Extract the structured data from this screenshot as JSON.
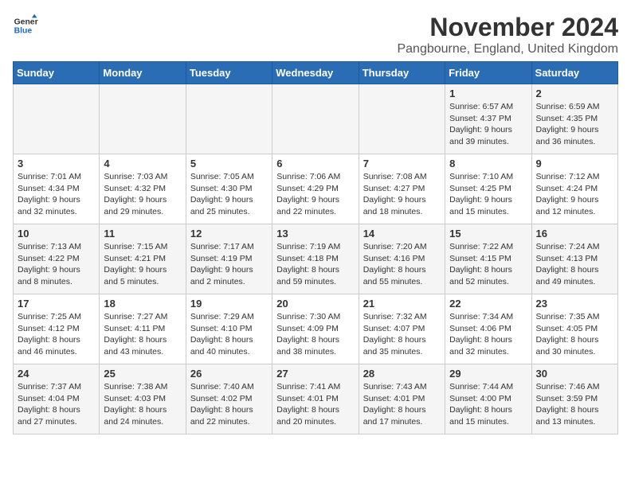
{
  "logo": {
    "text_general": "General",
    "text_blue": "Blue"
  },
  "header": {
    "month_year": "November 2024",
    "location": "Pangbourne, England, United Kingdom"
  },
  "weekdays": [
    "Sunday",
    "Monday",
    "Tuesday",
    "Wednesday",
    "Thursday",
    "Friday",
    "Saturday"
  ],
  "weeks": [
    [
      {
        "day": "",
        "info": ""
      },
      {
        "day": "",
        "info": ""
      },
      {
        "day": "",
        "info": ""
      },
      {
        "day": "",
        "info": ""
      },
      {
        "day": "",
        "info": ""
      },
      {
        "day": "1",
        "info": "Sunrise: 6:57 AM\nSunset: 4:37 PM\nDaylight: 9 hours\nand 39 minutes."
      },
      {
        "day": "2",
        "info": "Sunrise: 6:59 AM\nSunset: 4:35 PM\nDaylight: 9 hours\nand 36 minutes."
      }
    ],
    [
      {
        "day": "3",
        "info": "Sunrise: 7:01 AM\nSunset: 4:34 PM\nDaylight: 9 hours\nand 32 minutes."
      },
      {
        "day": "4",
        "info": "Sunrise: 7:03 AM\nSunset: 4:32 PM\nDaylight: 9 hours\nand 29 minutes."
      },
      {
        "day": "5",
        "info": "Sunrise: 7:05 AM\nSunset: 4:30 PM\nDaylight: 9 hours\nand 25 minutes."
      },
      {
        "day": "6",
        "info": "Sunrise: 7:06 AM\nSunset: 4:29 PM\nDaylight: 9 hours\nand 22 minutes."
      },
      {
        "day": "7",
        "info": "Sunrise: 7:08 AM\nSunset: 4:27 PM\nDaylight: 9 hours\nand 18 minutes."
      },
      {
        "day": "8",
        "info": "Sunrise: 7:10 AM\nSunset: 4:25 PM\nDaylight: 9 hours\nand 15 minutes."
      },
      {
        "day": "9",
        "info": "Sunrise: 7:12 AM\nSunset: 4:24 PM\nDaylight: 9 hours\nand 12 minutes."
      }
    ],
    [
      {
        "day": "10",
        "info": "Sunrise: 7:13 AM\nSunset: 4:22 PM\nDaylight: 9 hours\nand 8 minutes."
      },
      {
        "day": "11",
        "info": "Sunrise: 7:15 AM\nSunset: 4:21 PM\nDaylight: 9 hours\nand 5 minutes."
      },
      {
        "day": "12",
        "info": "Sunrise: 7:17 AM\nSunset: 4:19 PM\nDaylight: 9 hours\nand 2 minutes."
      },
      {
        "day": "13",
        "info": "Sunrise: 7:19 AM\nSunset: 4:18 PM\nDaylight: 8 hours\nand 59 minutes."
      },
      {
        "day": "14",
        "info": "Sunrise: 7:20 AM\nSunset: 4:16 PM\nDaylight: 8 hours\nand 55 minutes."
      },
      {
        "day": "15",
        "info": "Sunrise: 7:22 AM\nSunset: 4:15 PM\nDaylight: 8 hours\nand 52 minutes."
      },
      {
        "day": "16",
        "info": "Sunrise: 7:24 AM\nSunset: 4:13 PM\nDaylight: 8 hours\nand 49 minutes."
      }
    ],
    [
      {
        "day": "17",
        "info": "Sunrise: 7:25 AM\nSunset: 4:12 PM\nDaylight: 8 hours\nand 46 minutes."
      },
      {
        "day": "18",
        "info": "Sunrise: 7:27 AM\nSunset: 4:11 PM\nDaylight: 8 hours\nand 43 minutes."
      },
      {
        "day": "19",
        "info": "Sunrise: 7:29 AM\nSunset: 4:10 PM\nDaylight: 8 hours\nand 40 minutes."
      },
      {
        "day": "20",
        "info": "Sunrise: 7:30 AM\nSunset: 4:09 PM\nDaylight: 8 hours\nand 38 minutes."
      },
      {
        "day": "21",
        "info": "Sunrise: 7:32 AM\nSunset: 4:07 PM\nDaylight: 8 hours\nand 35 minutes."
      },
      {
        "day": "22",
        "info": "Sunrise: 7:34 AM\nSunset: 4:06 PM\nDaylight: 8 hours\nand 32 minutes."
      },
      {
        "day": "23",
        "info": "Sunrise: 7:35 AM\nSunset: 4:05 PM\nDaylight: 8 hours\nand 30 minutes."
      }
    ],
    [
      {
        "day": "24",
        "info": "Sunrise: 7:37 AM\nSunset: 4:04 PM\nDaylight: 8 hours\nand 27 minutes."
      },
      {
        "day": "25",
        "info": "Sunrise: 7:38 AM\nSunset: 4:03 PM\nDaylight: 8 hours\nand 24 minutes."
      },
      {
        "day": "26",
        "info": "Sunrise: 7:40 AM\nSunset: 4:02 PM\nDaylight: 8 hours\nand 22 minutes."
      },
      {
        "day": "27",
        "info": "Sunrise: 7:41 AM\nSunset: 4:01 PM\nDaylight: 8 hours\nand 20 minutes."
      },
      {
        "day": "28",
        "info": "Sunrise: 7:43 AM\nSunset: 4:01 PM\nDaylight: 8 hours\nand 17 minutes."
      },
      {
        "day": "29",
        "info": "Sunrise: 7:44 AM\nSunset: 4:00 PM\nDaylight: 8 hours\nand 15 minutes."
      },
      {
        "day": "30",
        "info": "Sunrise: 7:46 AM\nSunset: 3:59 PM\nDaylight: 8 hours\nand 13 minutes."
      }
    ]
  ]
}
